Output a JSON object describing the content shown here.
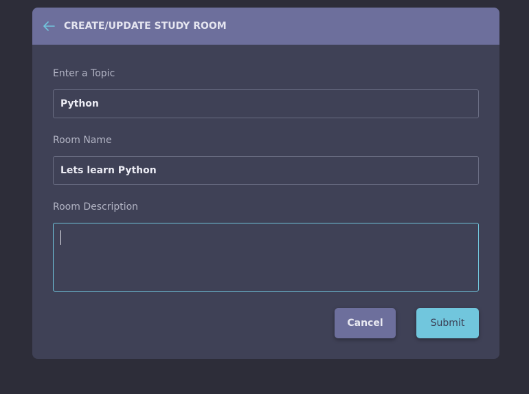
{
  "colors": {
    "page_background": "#2d2d39",
    "card_background": "#3f4156",
    "header_background": "#6d6f9c",
    "accent": "#71c6dd"
  },
  "header": {
    "back_icon": "arrow-left-icon",
    "title": "CREATE/UPDATE STUDY ROOM"
  },
  "form": {
    "topic": {
      "label": "Enter a Topic",
      "value": "Python"
    },
    "room_name": {
      "label": "Room Name",
      "value": "Lets learn Python"
    },
    "room_description": {
      "label": "Room Description",
      "value": ""
    }
  },
  "actions": {
    "cancel_label": "Cancel",
    "submit_label": "Submit"
  }
}
